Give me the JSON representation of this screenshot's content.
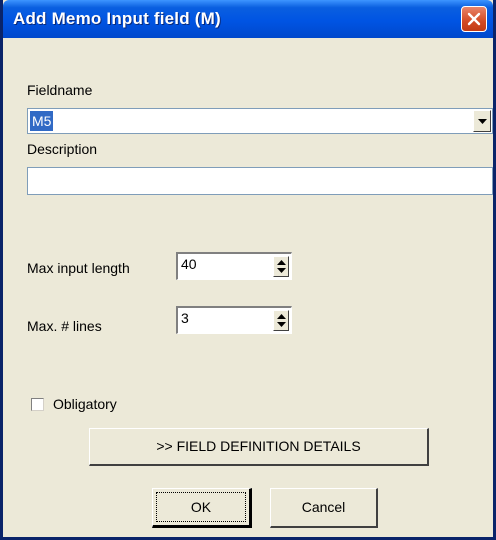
{
  "window": {
    "title": "Add Memo Input field (M)"
  },
  "fieldname": {
    "label": "Fieldname",
    "value": "M5"
  },
  "description": {
    "label": "Description",
    "value": ""
  },
  "max_input_length": {
    "label": "Max input length",
    "value": "40"
  },
  "max_lines": {
    "label": "Max. # lines",
    "value": "3"
  },
  "obligatory": {
    "label": "Obligatory",
    "checked": false
  },
  "buttons": {
    "details": ">> FIELD DEFINITION DETAILS",
    "ok": "OK",
    "cancel": "Cancel"
  },
  "colors": {
    "titlebar": "#0054e3",
    "selection": "#316ac5",
    "close": "#d34a24",
    "dialog_bg": "#ece9d8"
  },
  "icons": [
    "close-icon",
    "dropdown-arrow-icon",
    "spin-up-icon",
    "spin-down-icon"
  ]
}
